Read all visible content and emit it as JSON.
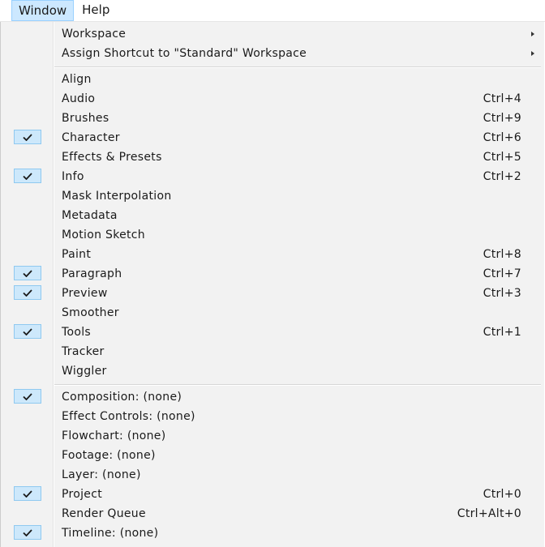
{
  "menubar": {
    "window_label": "Window",
    "help_label": "Help"
  },
  "menu": {
    "submenus": [
      {
        "label": "Workspace"
      },
      {
        "label": "Assign Shortcut to \"Standard\" Workspace"
      }
    ],
    "panels": [
      {
        "label": "Align",
        "shortcut": "",
        "checked": false
      },
      {
        "label": "Audio",
        "shortcut": "Ctrl+4",
        "checked": false
      },
      {
        "label": "Brushes",
        "shortcut": "Ctrl+9",
        "checked": false
      },
      {
        "label": "Character",
        "shortcut": "Ctrl+6",
        "checked": true
      },
      {
        "label": "Effects & Presets",
        "shortcut": "Ctrl+5",
        "checked": false
      },
      {
        "label": "Info",
        "shortcut": "Ctrl+2",
        "checked": true
      },
      {
        "label": "Mask Interpolation",
        "shortcut": "",
        "checked": false
      },
      {
        "label": "Metadata",
        "shortcut": "",
        "checked": false
      },
      {
        "label": "Motion Sketch",
        "shortcut": "",
        "checked": false
      },
      {
        "label": "Paint",
        "shortcut": "Ctrl+8",
        "checked": false
      },
      {
        "label": "Paragraph",
        "shortcut": "Ctrl+7",
        "checked": true
      },
      {
        "label": "Preview",
        "shortcut": "Ctrl+3",
        "checked": true
      },
      {
        "label": "Smoother",
        "shortcut": "",
        "checked": false
      },
      {
        "label": "Tools",
        "shortcut": "Ctrl+1",
        "checked": true
      },
      {
        "label": "Tracker",
        "shortcut": "",
        "checked": false
      },
      {
        "label": "Wiggler",
        "shortcut": "",
        "checked": false
      }
    ],
    "viewers": [
      {
        "label": "Composition: (none)",
        "shortcut": "",
        "checked": true
      },
      {
        "label": "Effect Controls: (none)",
        "shortcut": "",
        "checked": false
      },
      {
        "label": "Flowchart: (none)",
        "shortcut": "",
        "checked": false
      },
      {
        "label": "Footage: (none)",
        "shortcut": "",
        "checked": false
      },
      {
        "label": "Layer: (none)",
        "shortcut": "",
        "checked": false
      },
      {
        "label": "Project",
        "shortcut": "Ctrl+0",
        "checked": true
      },
      {
        "label": "Render Queue",
        "shortcut": "Ctrl+Alt+0",
        "checked": false
      },
      {
        "label": "Timeline: (none)",
        "shortcut": "",
        "checked": true
      }
    ]
  },
  "colors": {
    "menu_background": "#f2f2f2",
    "highlight": "#cce8ff",
    "check_box": "#cde8fb",
    "text": "#1a1a1a"
  },
  "icons": {
    "check": "checkmark-icon",
    "submenu": "submenu-arrow-icon"
  }
}
